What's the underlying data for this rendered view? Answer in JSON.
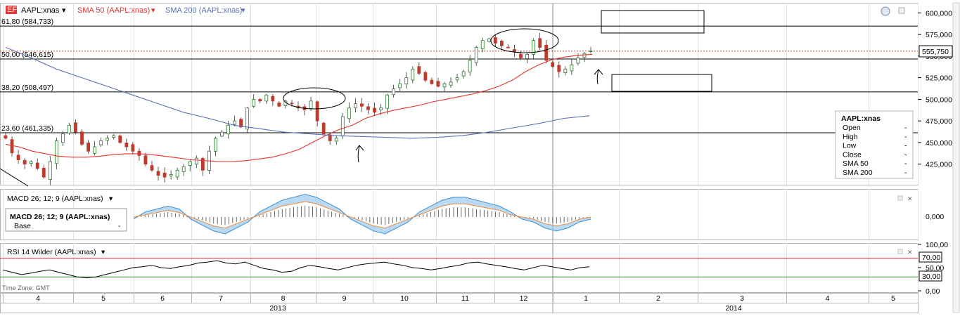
{
  "colors": {
    "price_up": "#2b7a2b",
    "price_down": "#c0392b",
    "sma50": "#e8322d",
    "sma200": "#5a72b5",
    "macd_fill_up": "#9cc9ef",
    "macd_fill_down": "#f7c6a3",
    "macd_line_blue": "#3a8fd6",
    "macd_line_orange": "#f08a3c",
    "rsi_line": "#000000",
    "rsi_70": "#d62c2c",
    "rsi_30": "#2c8f2c",
    "last_price_dotted": "#c0392b"
  },
  "header": {
    "symbol": "AAPL:xnas",
    "sma50": "SMA 50 (AAPL:xnas)",
    "sma200": "SMA 200 (AAPL:xnas)"
  },
  "fib_levels": [
    {
      "label": "61,80 (584,733)",
      "value": 584.733
    },
    {
      "label": "50,00 (546,615)",
      "value": 546.615
    },
    {
      "label": "38,20 (508,497)",
      "value": 508.497
    },
    {
      "label": "23,60 (461,335)",
      "value": 461.335
    }
  ],
  "last_price": {
    "label": "555,750",
    "value": 555.75
  },
  "price_axis": {
    "ticks": [
      "600,000",
      "575,000",
      "550,000",
      "525,000",
      "500,000",
      "475,000",
      "450,000",
      "425,000"
    ],
    "values": [
      600,
      575,
      550,
      525,
      500,
      475,
      450,
      425
    ],
    "ylim": [
      402,
      610
    ]
  },
  "legend": {
    "title": "AAPL:xnas",
    "rows": [
      {
        "label": "Open",
        "value": "-"
      },
      {
        "label": "High",
        "value": "-"
      },
      {
        "label": "Low",
        "value": "-"
      },
      {
        "label": "Close",
        "value": "-"
      },
      {
        "label": "SMA 50",
        "value": "-"
      },
      {
        "label": "SMA 200",
        "value": "-"
      }
    ]
  },
  "macd": {
    "title": "MACD 26; 12; 9 (AAPL:xnas)",
    "tooltip_title": "MACD 26; 12; 9 (AAPL:xnas)",
    "tooltip_row_label": "Base",
    "tooltip_row_value": "-",
    "tick": "0,000"
  },
  "rsi": {
    "title": "RSI 14 Wilder (AAPL:xnas)",
    "ticks": [
      "100,00",
      "50,00",
      "0,00"
    ],
    "level_high": "70,00",
    "level_low": "30,00"
  },
  "timezone": "Time Zone: GMT",
  "x_axis": {
    "months": [
      "4",
      "5",
      "6",
      "7",
      "8",
      "9",
      "10",
      "11",
      "12",
      "1",
      "2",
      "3",
      "4",
      "5"
    ],
    "years": [
      "2013",
      "2014"
    ]
  },
  "chart_data": {
    "type": "candlestick",
    "title": "",
    "price_series": {
      "name": "AAPL:xnas",
      "close": [
        455,
        438,
        430,
        425,
        428,
        420,
        410,
        428,
        452,
        460,
        470,
        462,
        448,
        440,
        445,
        452,
        455,
        458,
        450,
        445,
        440,
        435,
        425,
        418,
        412,
        410,
        413,
        418,
        422,
        428,
        432,
        418,
        440,
        455,
        462,
        470,
        475,
        468,
        490,
        500,
        498,
        505,
        498,
        492,
        498,
        495,
        490,
        488,
        498,
        475,
        460,
        452,
        455,
        480,
        490,
        495,
        492,
        488,
        485,
        490,
        505,
        512,
        518,
        525,
        535,
        530,
        522,
        518,
        515,
        518,
        520,
        525,
        532,
        545,
        560,
        568,
        570,
        565,
        562,
        560,
        555,
        548,
        552,
        568,
        560,
        545,
        538,
        532,
        535,
        540,
        548,
        553,
        556
      ],
      "range_y": [
        402,
        610
      ]
    },
    "sma50": {
      "name": "SMA 50",
      "values": [
        448,
        445,
        440,
        437,
        434,
        433,
        433,
        434,
        436,
        437,
        437,
        436,
        434,
        432,
        430,
        429,
        428,
        428,
        429,
        431,
        433,
        437,
        442,
        450,
        458,
        465,
        470,
        478,
        483,
        487,
        490,
        493,
        497,
        500,
        503,
        506,
        510,
        515,
        522,
        532,
        540,
        546,
        549,
        551,
        552
      ]
    },
    "sma200": {
      "name": "SMA 200",
      "values": [
        560,
        548,
        535,
        525,
        515,
        505,
        495,
        485,
        478,
        470,
        466,
        462,
        460,
        458,
        457,
        456,
        455,
        456,
        458,
        462,
        467,
        472,
        478,
        481
      ]
    },
    "macd_histogram": [
      0,
      1,
      2,
      3,
      2,
      0,
      -2,
      -4,
      -5,
      -3,
      -1,
      1,
      3,
      5,
      6,
      7,
      6,
      4,
      2,
      0,
      -2,
      -4,
      -5,
      -3,
      -1,
      1,
      3,
      5,
      6,
      6,
      5,
      4,
      3,
      1,
      0,
      -1,
      -3,
      -4,
      -3,
      -1,
      0
    ],
    "rsi": [
      45,
      40,
      35,
      38,
      42,
      45,
      40,
      35,
      30,
      28,
      30,
      35,
      40,
      45,
      50,
      52,
      55,
      50,
      48,
      52,
      55,
      60,
      62,
      65,
      60,
      58,
      62,
      55,
      48,
      45,
      40,
      42,
      50,
      55,
      52,
      48,
      45,
      50,
      55,
      58,
      60,
      62,
      58,
      55,
      50,
      48,
      45,
      48,
      52,
      55,
      60,
      62,
      58,
      55,
      52,
      48,
      45,
      50,
      55,
      52,
      48,
      45,
      50,
      52
    ]
  }
}
